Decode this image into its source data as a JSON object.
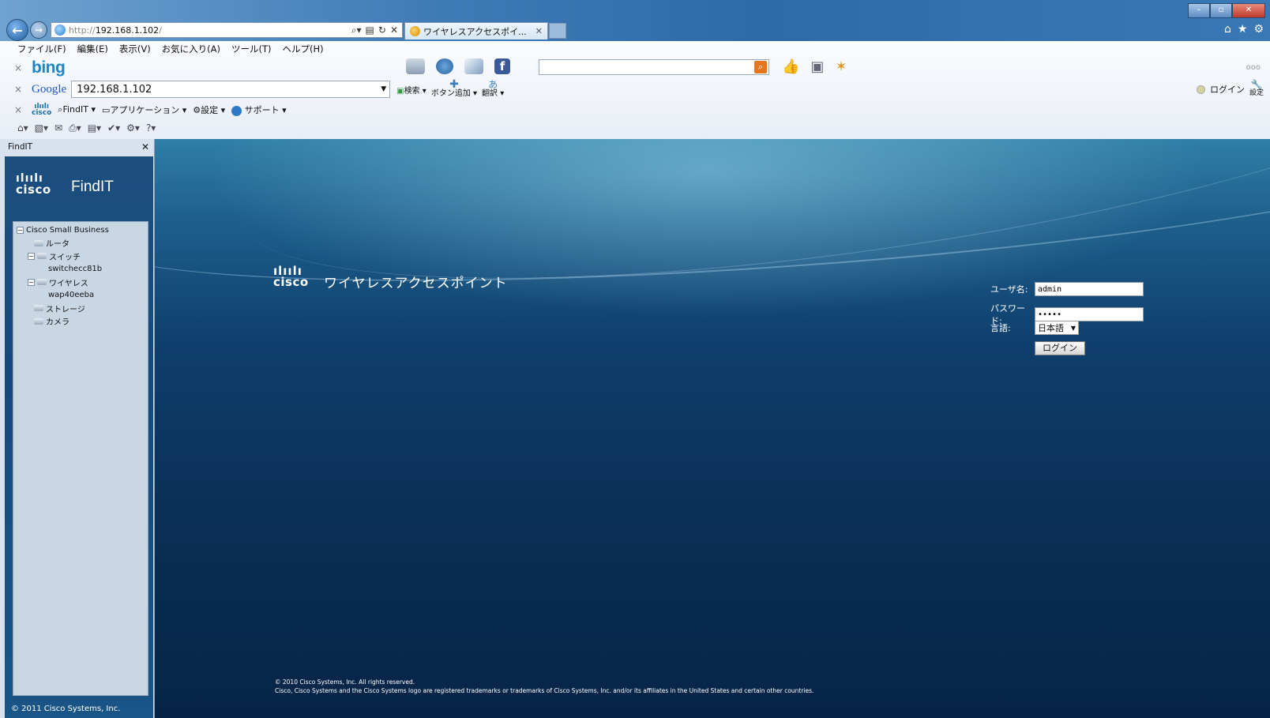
{
  "browser": {
    "address": {
      "proto": "http://",
      "host": "192.168.1.102",
      "path": "/"
    },
    "tab_title": "ワイヤレスアクセスポイ...",
    "menu": [
      "ファイル(F)",
      "編集(E)",
      "表示(V)",
      "お気に入り(A)",
      "ツール(T)",
      "ヘルプ(H)"
    ],
    "bing": {
      "logo": "bing"
    },
    "google": {
      "logo": "Google",
      "query": "192.168.1.102",
      "search_label": "検索",
      "add_button_label": "ボタン追加",
      "translate_label": "翻訳",
      "login_label": "ログイン",
      "settings_label": "設定"
    },
    "cisco_toolbar": {
      "findit_label": "FindIT",
      "apps_label": "アプリケーション",
      "settings_label": "設定",
      "support_label": "サポート"
    }
  },
  "sidebar": {
    "header": "FindIT",
    "logo_word": "cisco",
    "title": "FindIT",
    "tree": [
      {
        "label": "Cisco Small Business",
        "level": 0,
        "expander": "−"
      },
      {
        "label": "ルータ",
        "level": 1
      },
      {
        "label": "スイッチ",
        "level": 1,
        "expander": "−"
      },
      {
        "label": "switchecc81b",
        "level": 2
      },
      {
        "label": "ワイヤレス",
        "level": 1,
        "expander": "−"
      },
      {
        "label": "wap40eeba",
        "level": 2
      },
      {
        "label": "ストレージ",
        "level": 1
      },
      {
        "label": "カメラ",
        "level": 1
      }
    ],
    "footer": "© 2011 Cisco Systems, Inc."
  },
  "main": {
    "logo_word": "cisco",
    "title": "ワイヤレスアクセスポイント",
    "login": {
      "username_label": "ユーザ名:",
      "username_value": "admin",
      "password_label": "パスワード:",
      "password_value": "•••••",
      "language_label": "言語:",
      "language_value": "日本語",
      "login_button": "ログイン"
    },
    "copyright_1": "© 2010 Cisco Systems, Inc. All rights reserved.",
    "copyright_2": "Cisco, Cisco Systems and the Cisco Systems logo are registered trademarks or trademarks of Cisco Systems, Inc. and/or its affiliates in the United States and certain other countries."
  }
}
